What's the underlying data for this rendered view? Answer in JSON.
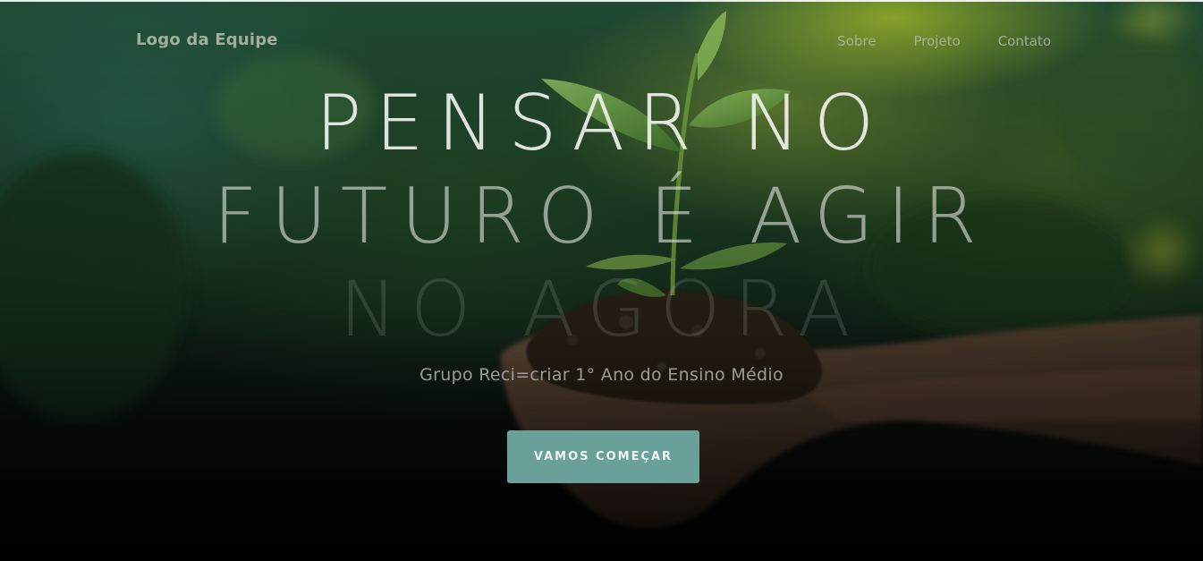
{
  "header": {
    "logo": "Logo da Equipe",
    "nav": [
      {
        "label": "Sobre"
      },
      {
        "label": "Projeto"
      },
      {
        "label": "Contato"
      }
    ]
  },
  "hero": {
    "headline_lines": [
      "PENSAR NO",
      "FUTURO É AGIR",
      "NO AGORA"
    ],
    "subtitle": "Grupo Reci=criar 1° Ano do Ensino Médio",
    "cta_label": "VAMOS COMEÇAR"
  },
  "colors": {
    "accent": "#69a09a",
    "background_dark": "#030404",
    "foliage_green": "#1f4a35"
  }
}
